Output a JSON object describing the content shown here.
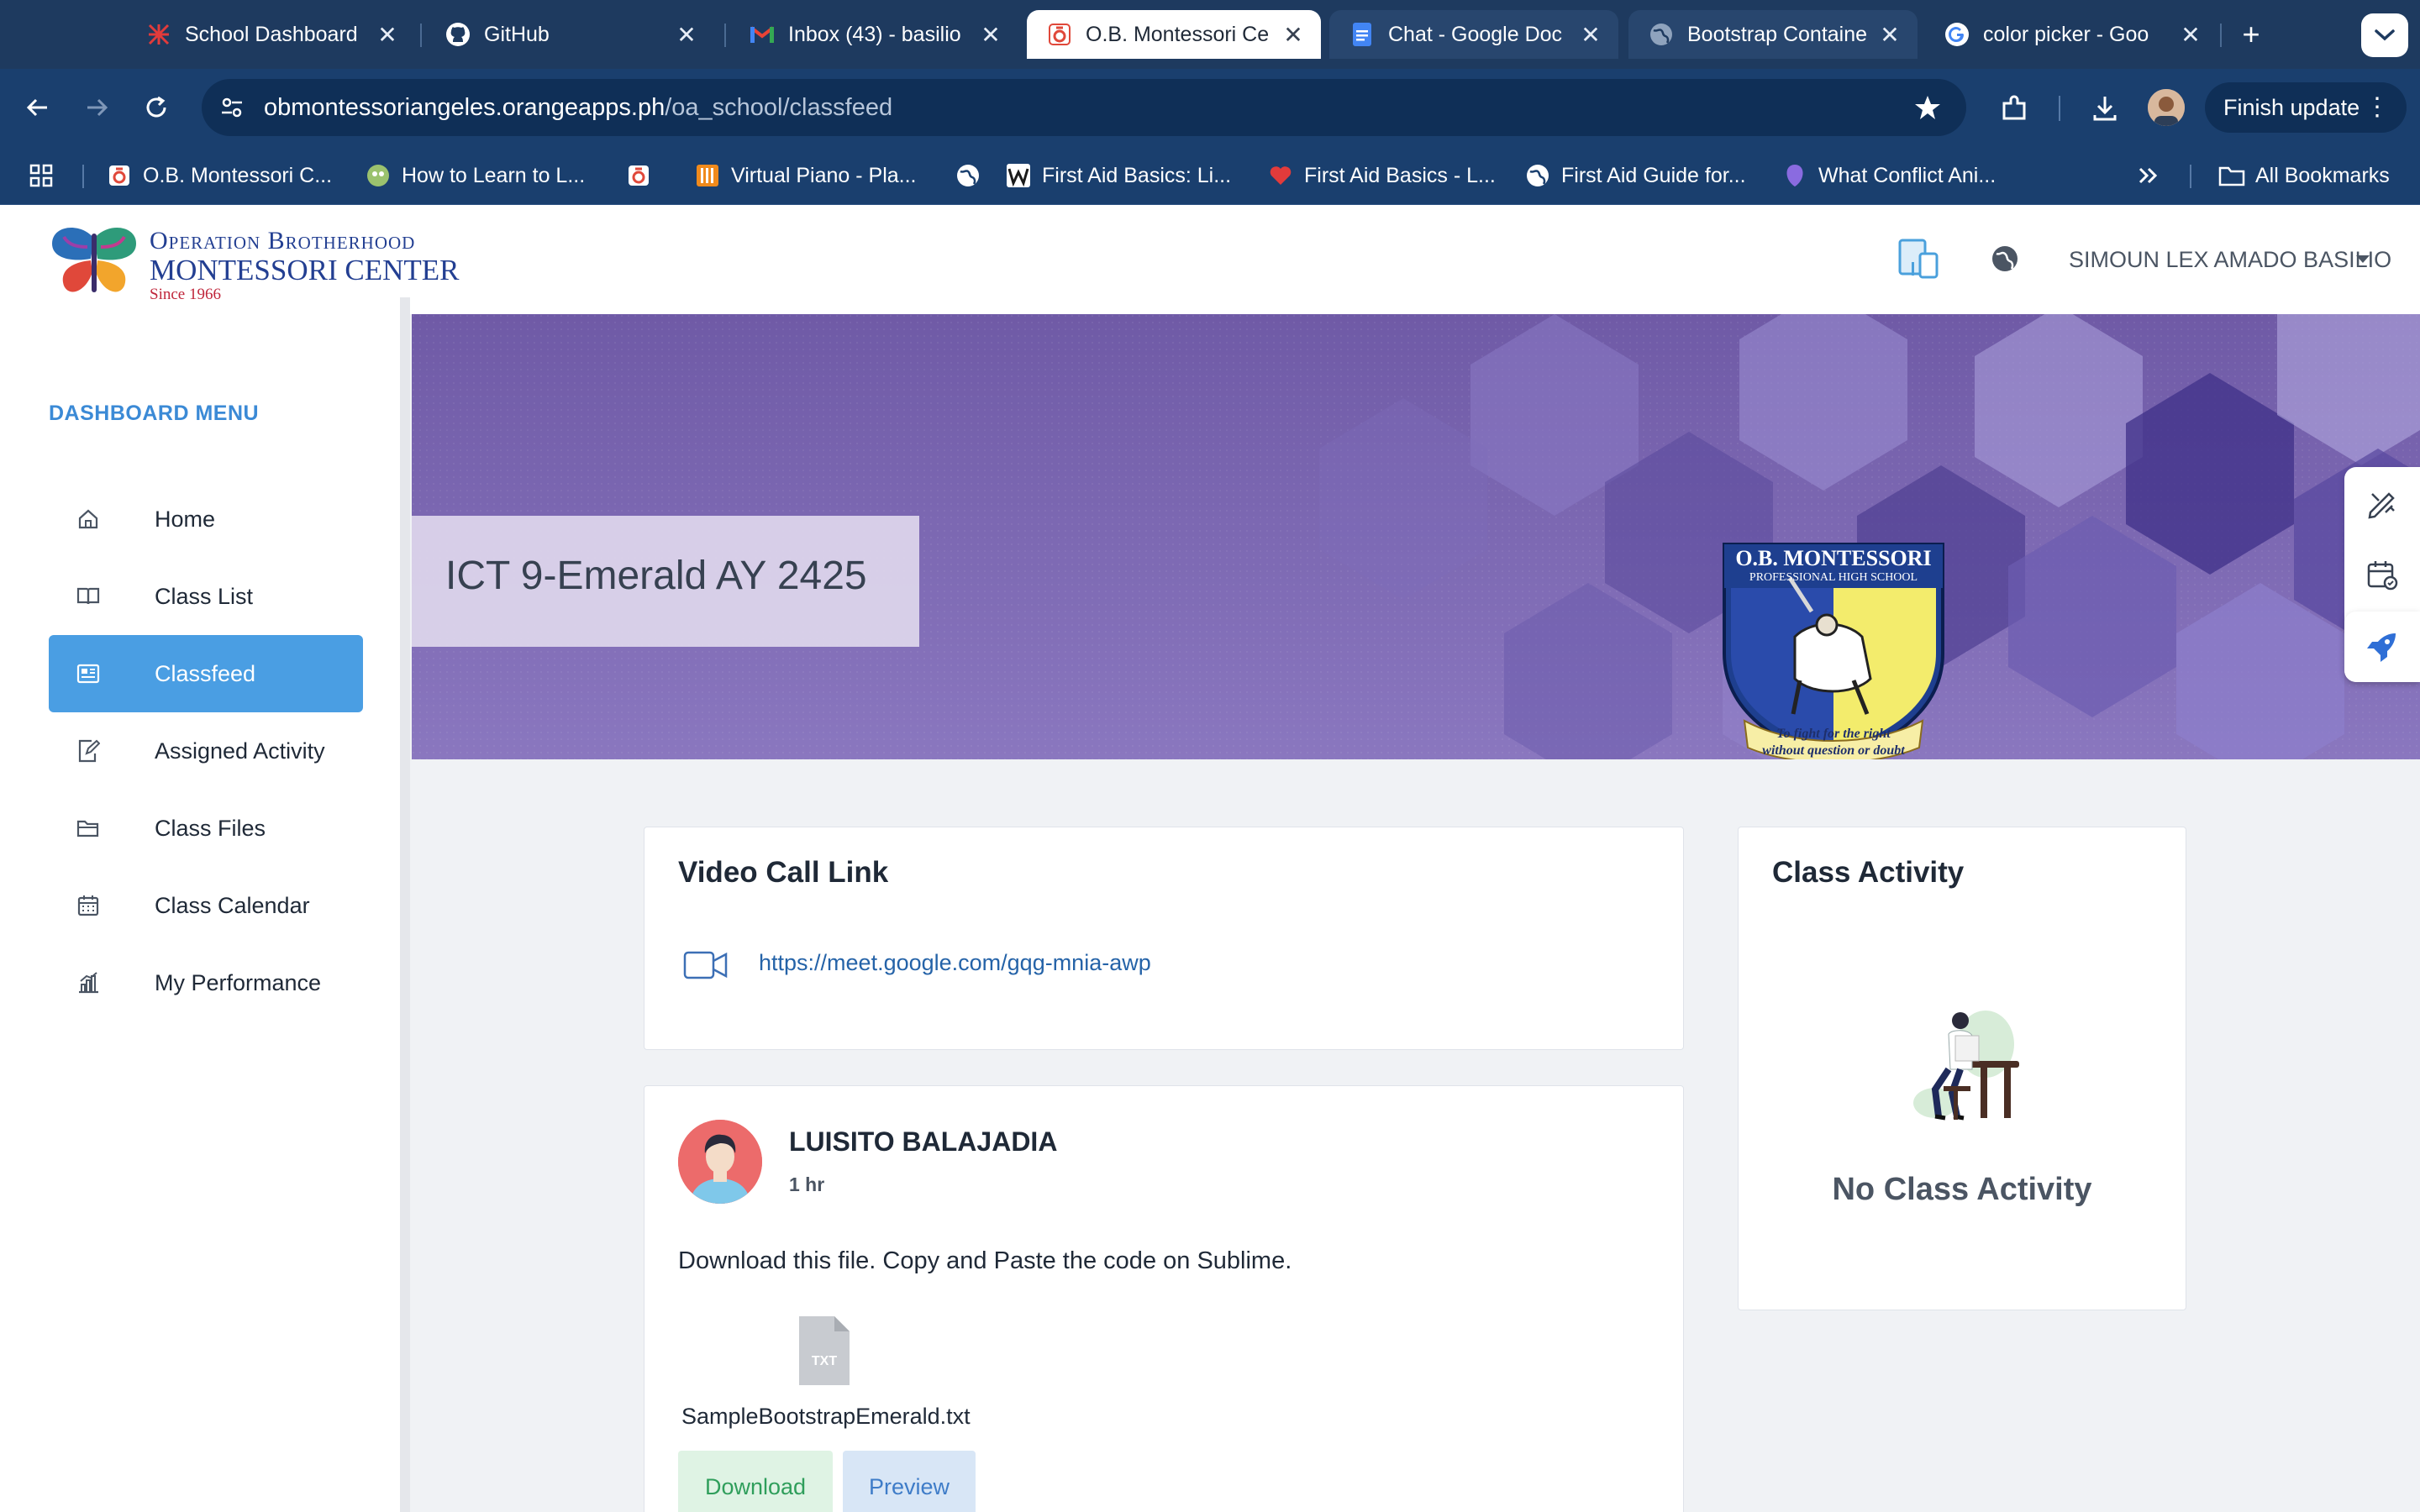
{
  "browser": {
    "tabs": [
      {
        "title": "School Dashboard",
        "icon": "school-favicon-red"
      },
      {
        "title": "GitHub",
        "icon": "github-icon"
      },
      {
        "title": "Inbox (43) - basilio",
        "icon": "gmail-icon"
      },
      {
        "title": "O.B. Montessori Ce",
        "icon": "obm-favicon"
      },
      {
        "title": "Chat - Google Doc",
        "icon": "google-docs-icon"
      },
      {
        "title": "Bootstrap Containe",
        "icon": "globe-icon"
      },
      {
        "title": "color picker - Goo",
        "icon": "google-icon"
      }
    ],
    "url_host": "obmontessoriangeles.orangeapps.ph",
    "url_path": "/oa_school/classfeed",
    "finish_update_label": "Finish update",
    "bookmarks": [
      {
        "label": "O.B. Montessori C...",
        "icon": "obm-favicon"
      },
      {
        "label": "How to Learn to L...",
        "icon": "language-icon"
      },
      {
        "label": "",
        "icon": "obm-favicon"
      },
      {
        "label": "Virtual Piano - Pla...",
        "icon": "piano-icon"
      },
      {
        "label": "",
        "icon": "globe-icon"
      },
      {
        "label": "First Aid Basics: Li...",
        "icon": "w-icon"
      },
      {
        "label": "First Aid Basics - L...",
        "icon": "heart-icon"
      },
      {
        "label": "First Aid Guide for...",
        "icon": "globe-icon"
      },
      {
        "label": "What Conflict Ani...",
        "icon": "conflict-icon"
      }
    ],
    "all_bookmarks_label": "All Bookmarks"
  },
  "header": {
    "logo_line1": "Operation Brotherhood",
    "logo_line2": "MONTESSORI CENTER",
    "logo_line3": "Since 1966",
    "user_name": "SIMOUN LEX AMADO BASILIO"
  },
  "sidebar": {
    "title": "DASHBOARD MENU",
    "items": [
      {
        "label": "Home",
        "icon": "home-icon",
        "active": false
      },
      {
        "label": "Class List",
        "icon": "book-icon",
        "active": false
      },
      {
        "label": "Classfeed",
        "icon": "newspaper-icon",
        "active": true
      },
      {
        "label": "Assigned Activity",
        "icon": "edit-document-icon",
        "active": false
      },
      {
        "label": "Class Files",
        "icon": "folder-icon",
        "active": false
      },
      {
        "label": "Class Calendar",
        "icon": "calendar-icon",
        "active": false
      },
      {
        "label": "My Performance",
        "icon": "bar-chart-icon",
        "active": false
      }
    ]
  },
  "banner": {
    "class_title": "ICT 9-Emerald AY 2425",
    "crest_line1": "O.B. MONTESSORI",
    "crest_line2": "PROFESSIONAL HIGH SCHOOL",
    "crest_motto": "To fight for the right without question or doubt"
  },
  "video_call": {
    "title": "Video Call Link",
    "link": "https://meet.google.com/gqg-mnia-awp"
  },
  "post": {
    "author": "LUISITO BALAJADIA",
    "time": "1 hr",
    "text": "Download this file. Copy and Paste the code on Sublime.",
    "file_type": "TXT",
    "file_name": "SampleBootstrapEmerald.txt",
    "download_label": "Download",
    "preview_label": "Preview"
  },
  "class_activity": {
    "title": "Class Activity",
    "empty_text": "No Class Activity"
  },
  "colors": {
    "sidebar_active": "#4a9ee3",
    "menu_title": "#3b8ad6",
    "banner_purple": "#6f5aa6",
    "link_blue": "#2563a8"
  }
}
